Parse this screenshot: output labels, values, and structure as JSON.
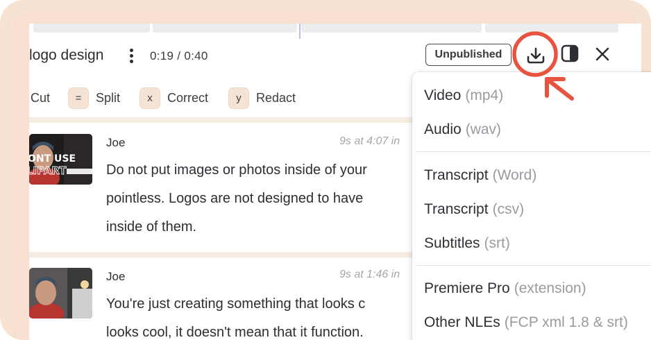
{
  "header": {
    "title": "logo design",
    "time": "0:19 / 0:40",
    "publish_status": "Unpublished"
  },
  "shortcuts": [
    {
      "key": "",
      "label": "Cut"
    },
    {
      "key": "=",
      "label": "Split"
    },
    {
      "key": "x",
      "label": "Correct"
    },
    {
      "key": "y",
      "label": "Redact"
    }
  ],
  "segments": [
    {
      "speaker": "Joe",
      "stamp": "9s at 4:07 in",
      "thumb_text": [
        "ONT USE",
        "LIPART"
      ],
      "lines": [
        "Do not put images or photos inside of your",
        "pointless. Logos are not designed to have",
        "inside of them."
      ]
    },
    {
      "speaker": "Joe",
      "stamp": "9s at 1:46 in",
      "lines": [
        "You're just creating something that looks c",
        "looks cool, it doesn't mean that it function."
      ]
    }
  ],
  "export_menu": {
    "groups": [
      [
        {
          "label": "Video",
          "ext": "(mp4)"
        },
        {
          "label": "Audio",
          "ext": "(wav)"
        }
      ],
      [
        {
          "label": "Transcript",
          "ext": "(Word)"
        },
        {
          "label": "Transcript",
          "ext": "(csv)"
        },
        {
          "label": "Subtitles",
          "ext": "(srt)"
        }
      ],
      [
        {
          "label": "Premiere Pro",
          "ext": "(extension)"
        },
        {
          "label": "Other NLEs",
          "ext": "(FCP xml 1.8 & srt)"
        }
      ]
    ]
  },
  "icons": {
    "more": "more-vertical-icon",
    "download": "download-icon",
    "layout": "sidebar-toggle-icon",
    "close": "close-icon"
  },
  "colors": {
    "frame": "#f8e3d3",
    "annotation": "#e8533f",
    "key_bg": "#f5e4d6"
  }
}
